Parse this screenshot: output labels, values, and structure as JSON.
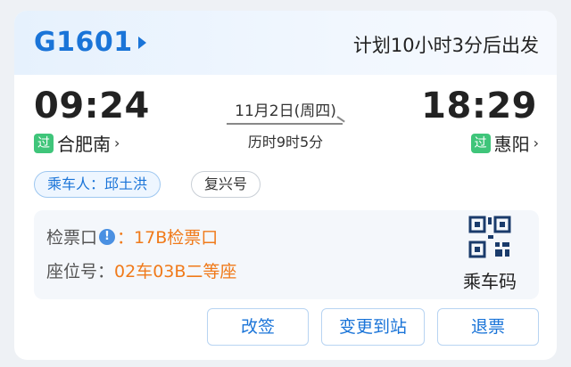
{
  "header": {
    "train_number": "G1601",
    "countdown": "计划10小时3分后出发"
  },
  "trip": {
    "departure_time": "09:24",
    "departure_station": "合肥南",
    "arrival_time": "18:29",
    "arrival_station": "惠阳",
    "pass_badge": "过",
    "date": "11月2日(周四)",
    "duration": "历时9时5分"
  },
  "tags": {
    "passenger": "乘车人：邱土洪",
    "train_type": "复兴号"
  },
  "info": {
    "gate_label": "检票口",
    "gate_value": "：17B检票口",
    "seat_label": "座位号：",
    "seat_value": "02车03B二等座",
    "qr_label": "乘车码"
  },
  "buttons": {
    "change": "改签",
    "change_station": "变更到站",
    "refund": "退票"
  },
  "colors": {
    "accent": "#1a74d8",
    "highlight": "#f07a1a",
    "badge": "#3fc57a"
  }
}
